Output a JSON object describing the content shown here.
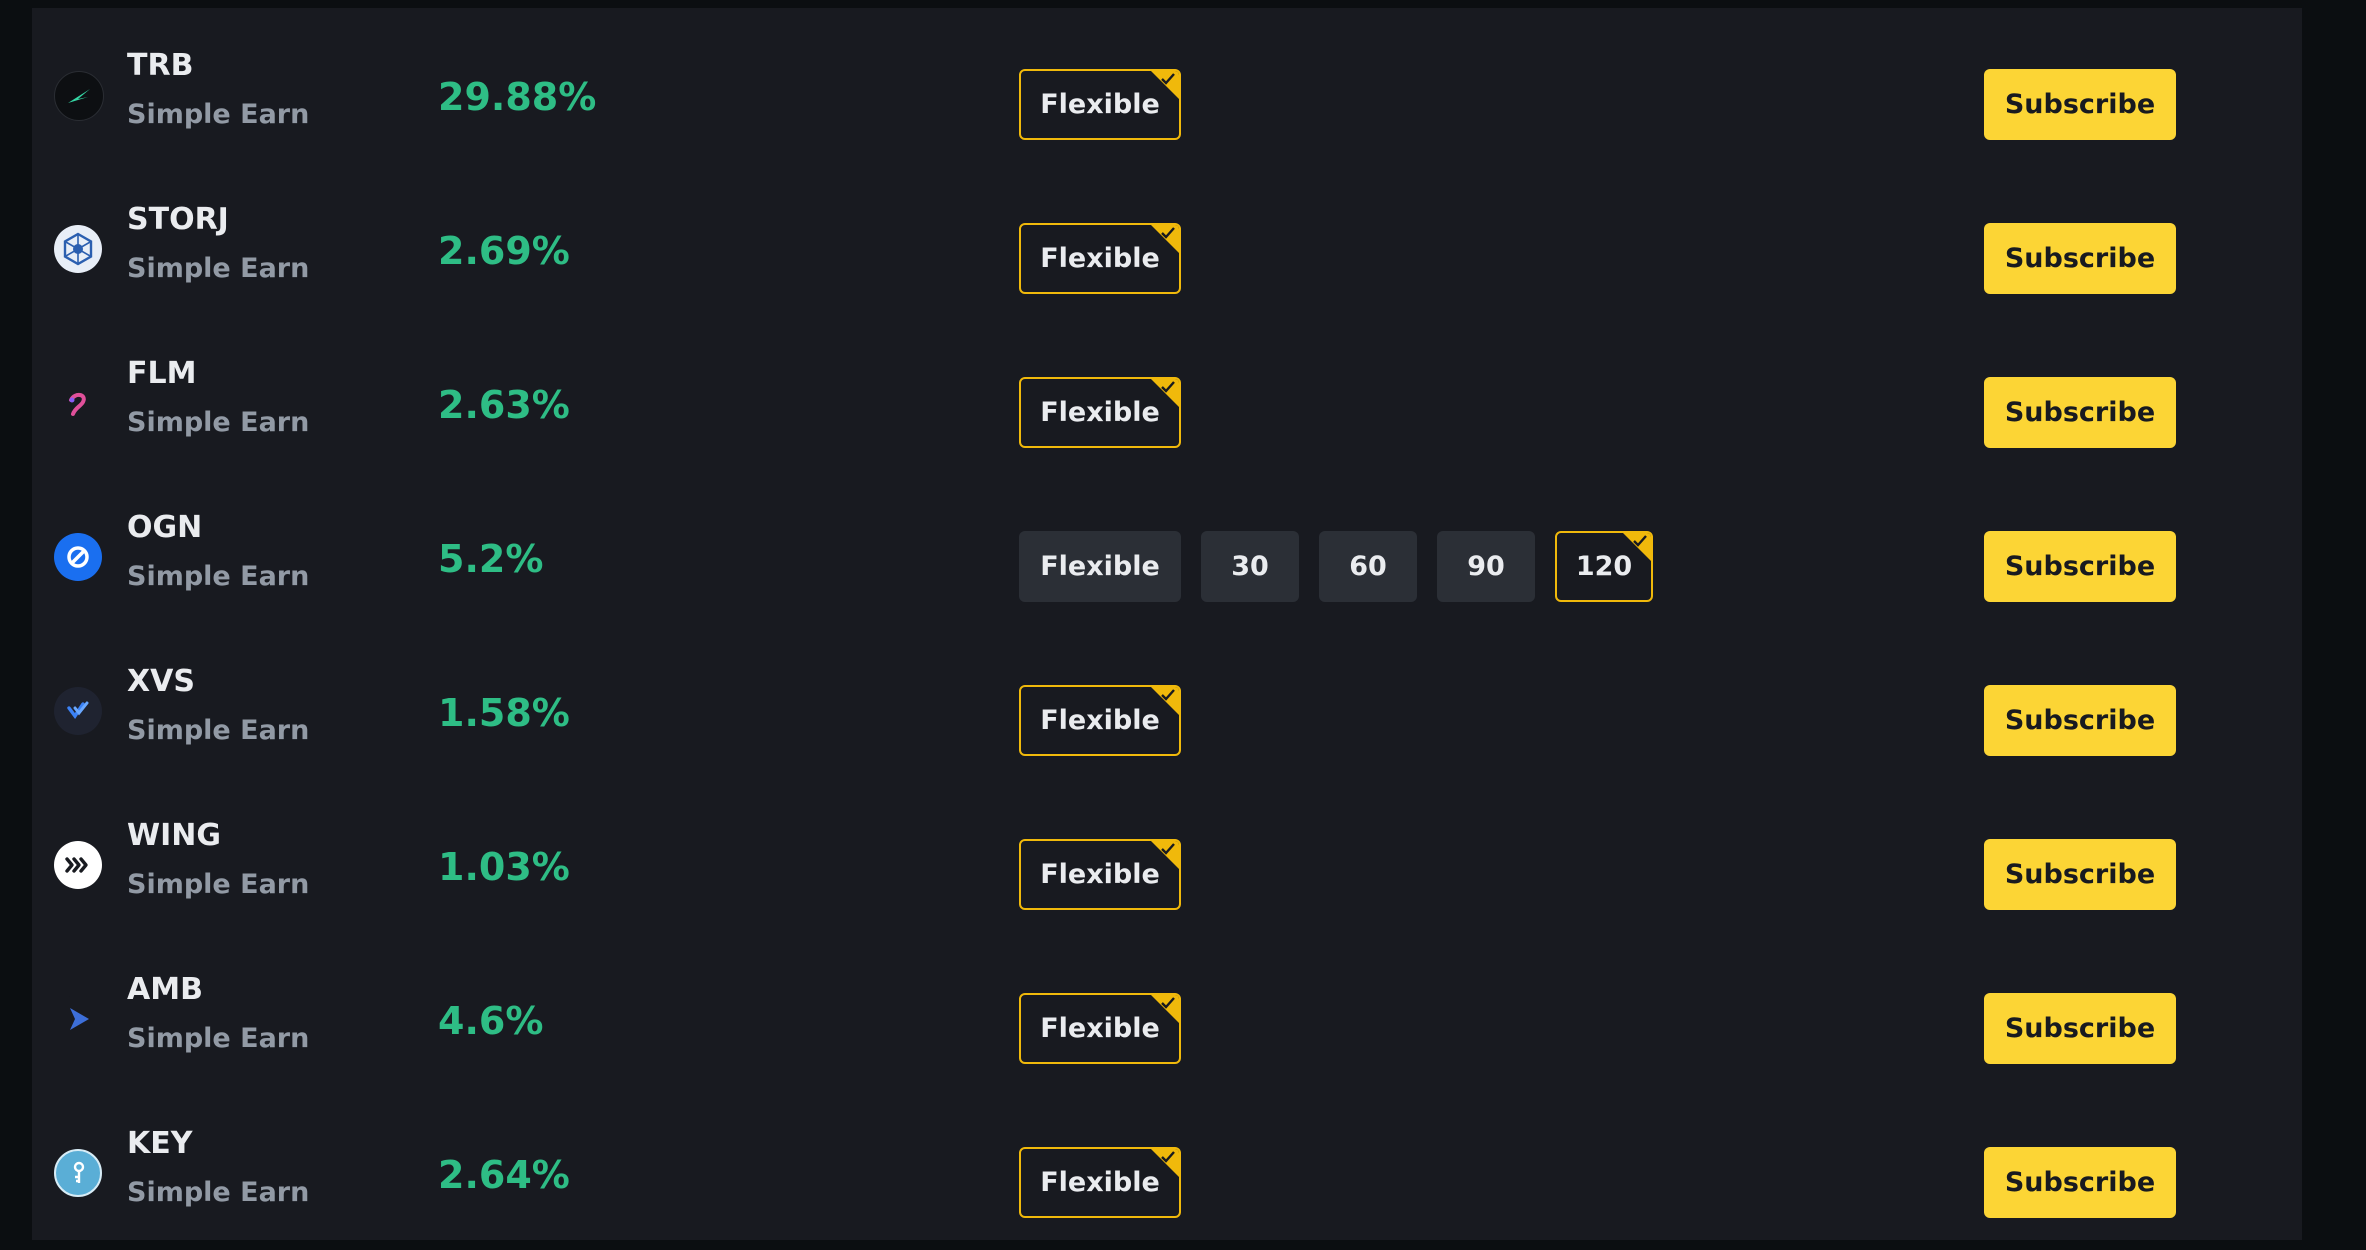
{
  "rows": [
    {
      "symbol": "TRB",
      "product": "Simple Earn",
      "apr": "29.88%",
      "icon": "trb-coin-icon",
      "durations": [
        {
          "label": "Flexible",
          "selected": true
        }
      ],
      "action": "Subscribe"
    },
    {
      "symbol": "STORJ",
      "product": "Simple Earn",
      "apr": "2.69%",
      "icon": "storj-coin-icon",
      "durations": [
        {
          "label": "Flexible",
          "selected": true
        }
      ],
      "action": "Subscribe"
    },
    {
      "symbol": "FLM",
      "product": "Simple Earn",
      "apr": "2.63%",
      "icon": "flm-coin-icon",
      "durations": [
        {
          "label": "Flexible",
          "selected": true
        }
      ],
      "action": "Subscribe"
    },
    {
      "symbol": "OGN",
      "product": "Simple Earn",
      "apr": "5.2%",
      "icon": "ogn-coin-icon",
      "durations": [
        {
          "label": "Flexible",
          "selected": false
        },
        {
          "label": "30",
          "selected": false
        },
        {
          "label": "60",
          "selected": false
        },
        {
          "label": "90",
          "selected": false
        },
        {
          "label": "120",
          "selected": true
        }
      ],
      "action": "Subscribe"
    },
    {
      "symbol": "XVS",
      "product": "Simple Earn",
      "apr": "1.58%",
      "icon": "xvs-coin-icon",
      "durations": [
        {
          "label": "Flexible",
          "selected": true
        }
      ],
      "action": "Subscribe"
    },
    {
      "symbol": "WING",
      "product": "Simple Earn",
      "apr": "1.03%",
      "icon": "wing-coin-icon",
      "durations": [
        {
          "label": "Flexible",
          "selected": true
        }
      ],
      "action": "Subscribe"
    },
    {
      "symbol": "AMB",
      "product": "Simple Earn",
      "apr": "4.6%",
      "icon": "amb-coin-icon",
      "durations": [
        {
          "label": "Flexible",
          "selected": true
        }
      ],
      "action": "Subscribe"
    },
    {
      "symbol": "KEY",
      "product": "Simple Earn",
      "apr": "2.64%",
      "icon": "key-coin-icon",
      "durations": [
        {
          "label": "Flexible",
          "selected": true
        }
      ],
      "action": "Subscribe"
    }
  ],
  "colors": {
    "background": "#0b0e11",
    "panel": "#181a20",
    "apr_green": "#2ebd85",
    "accent_yellow": "#fcd535",
    "selected_border": "#f0b90b",
    "unselected_chip": "#2b2f36"
  }
}
